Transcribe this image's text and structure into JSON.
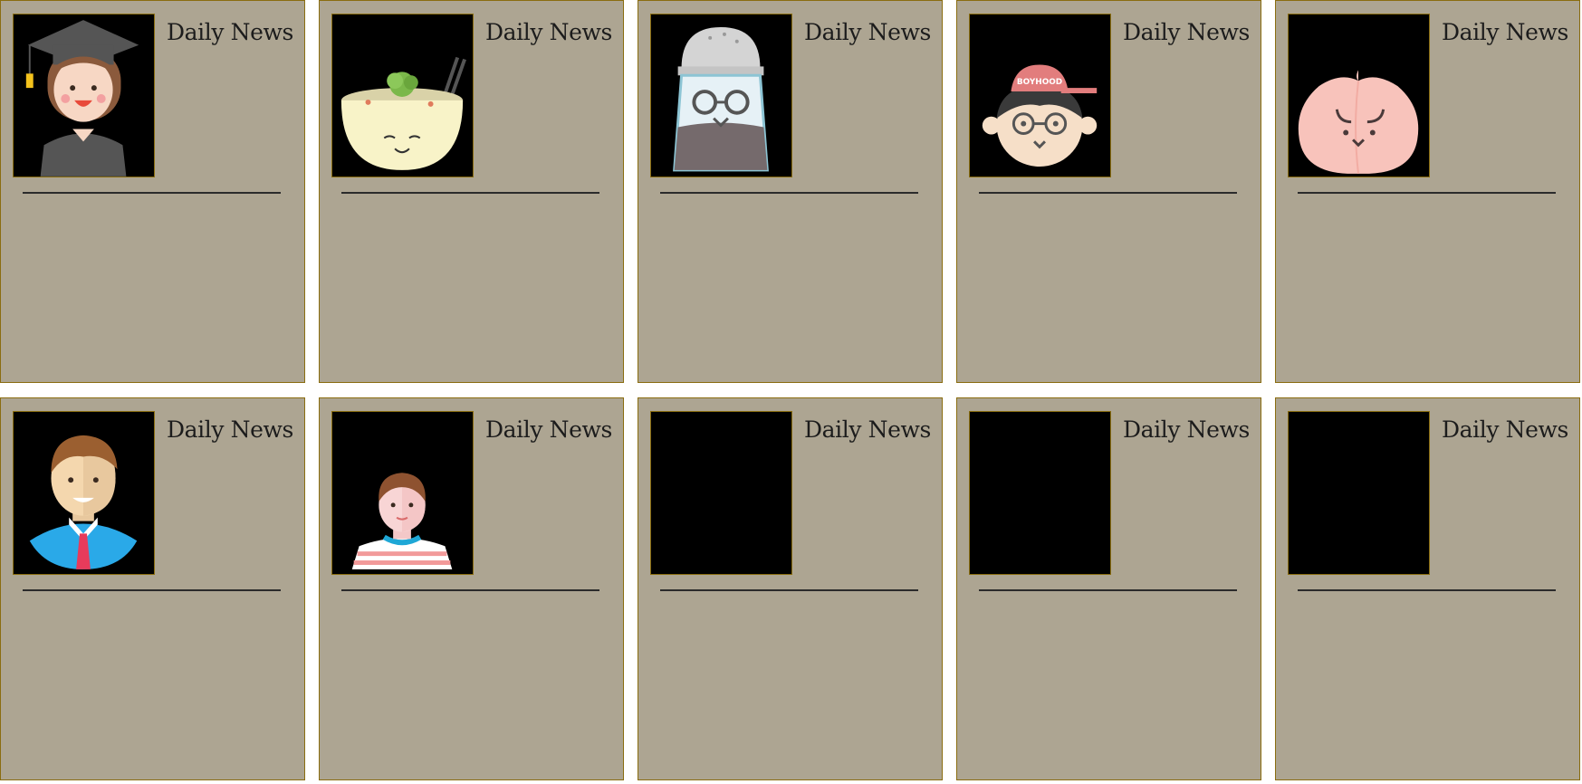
{
  "cards": [
    {
      "title": "Daily News",
      "avatar": "graduate-girl-icon"
    },
    {
      "title": "Daily News",
      "avatar": "noodle-bowl-icon"
    },
    {
      "title": "Daily News",
      "avatar": "pepper-shaker-icon"
    },
    {
      "title": "Daily News",
      "avatar": "boyhood-cap-boy-icon"
    },
    {
      "title": "Daily News",
      "avatar": "peach-icon"
    },
    {
      "title": "Daily News",
      "avatar": "businessman-icon"
    },
    {
      "title": "Daily News",
      "avatar": "striped-shirt-boy-icon"
    },
    {
      "title": "Daily News",
      "avatar": ""
    },
    {
      "title": "Daily News",
      "avatar": ""
    },
    {
      "title": "Daily News",
      "avatar": ""
    }
  ],
  "labels": {
    "cap_text": "BOYHOOD"
  },
  "colors": {
    "card_bg": "#ada592",
    "card_border": "#8a6d10",
    "thumb_bg": "#000000",
    "rule": "#2b2b2b"
  }
}
